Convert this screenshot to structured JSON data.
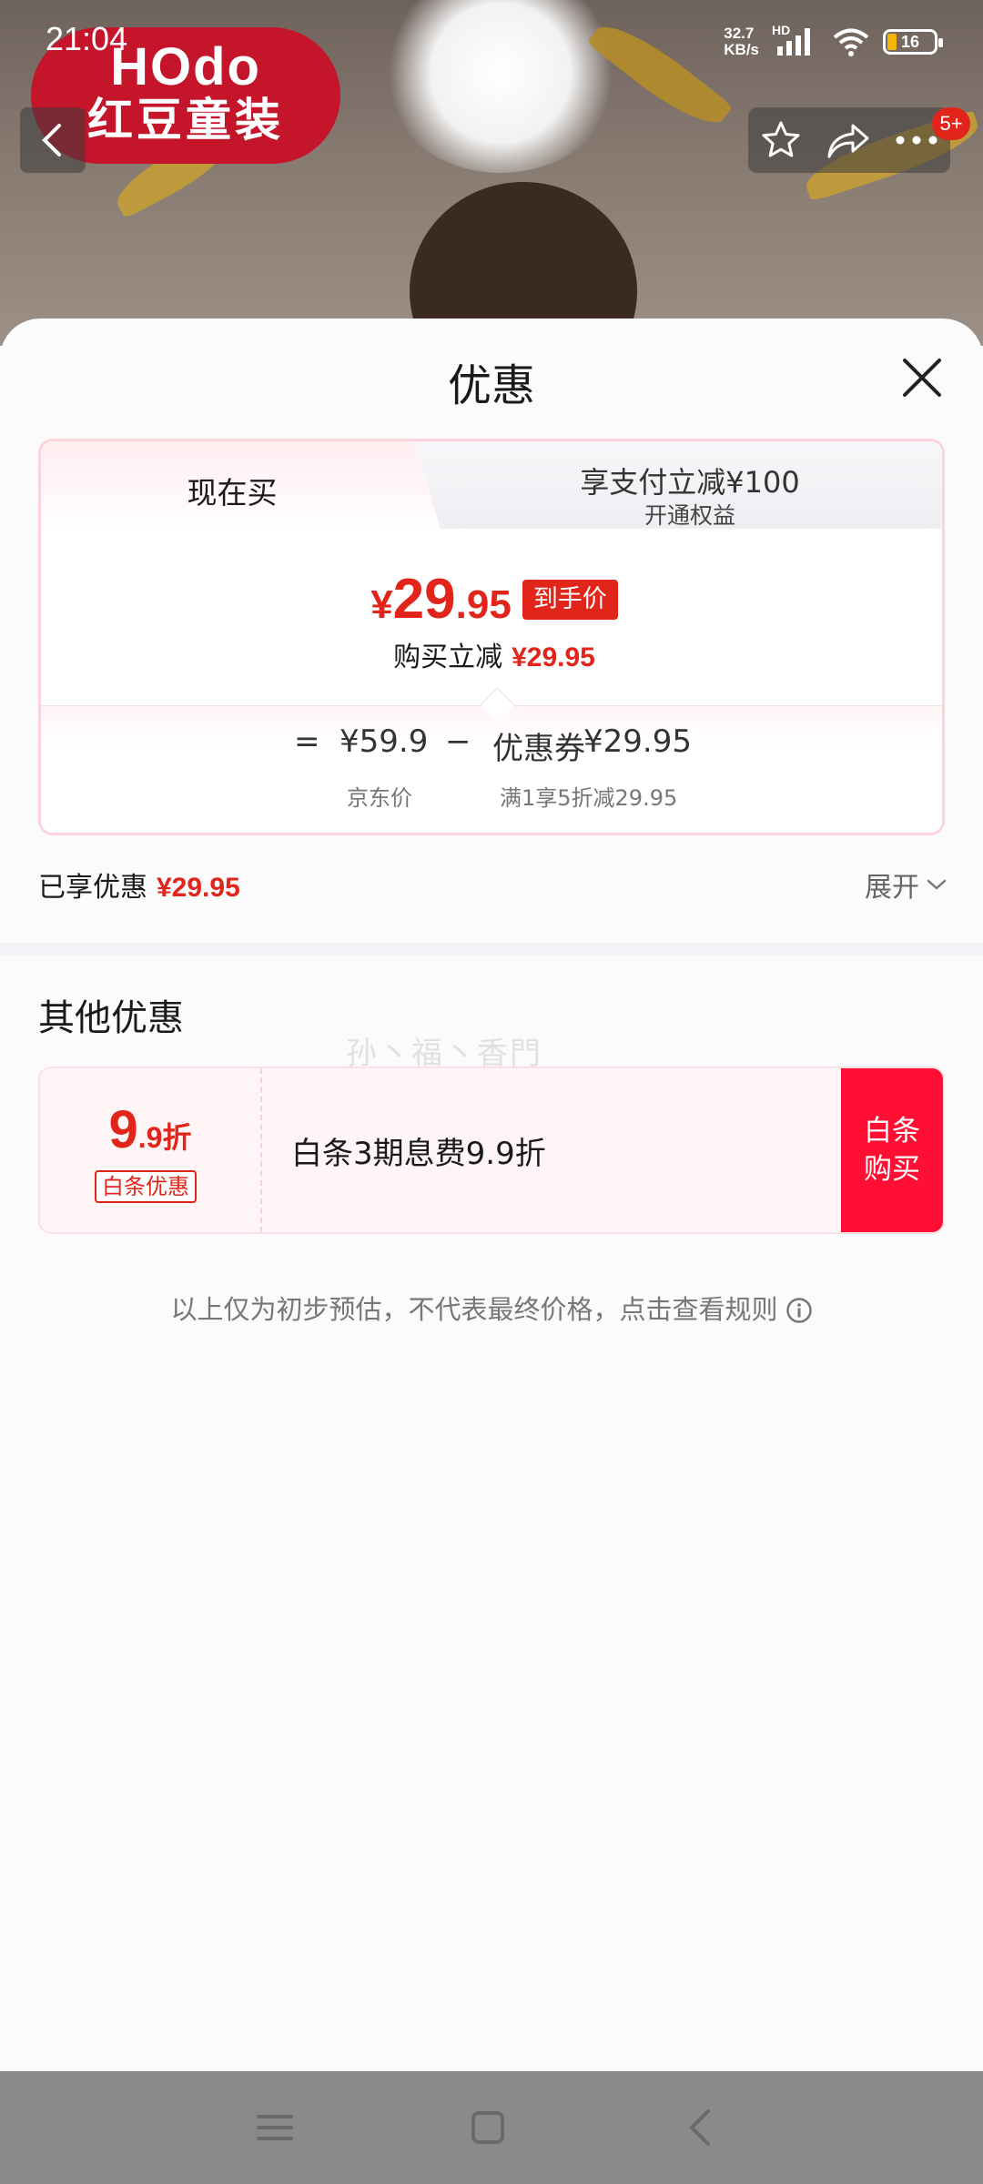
{
  "status_bar": {
    "time": "21:04",
    "net_speed_value": "32.7",
    "net_speed_unit": "KB/s",
    "network_tag": "HD",
    "battery": "16"
  },
  "hero": {
    "brand_logo_en": "HOdo",
    "brand_logo_cn": "红豆童装"
  },
  "top_nav": {
    "badge": "5+"
  },
  "sheet": {
    "title": "优惠",
    "tabs": {
      "active": "现在买",
      "other_main": "享支付立减¥100",
      "other_sub": "开通权益"
    },
    "final_price": {
      "yen": "¥",
      "integer": "29",
      "decimal": ".95",
      "tag": "到手价"
    },
    "reduce": {
      "label": "购买立减",
      "amount": "¥29.95"
    },
    "calc": {
      "equals": "=",
      "jd_price": "¥59.9",
      "minus": "−",
      "coupon_label": "优惠券",
      "coupon_value": "¥29.95",
      "jd_price_label": "京东价",
      "coupon_rule": "满1享5折减29.95"
    },
    "enjoyed": {
      "label": "已享优惠",
      "amount": "¥29.95",
      "expand": "展开"
    },
    "other": {
      "title": "其他优惠",
      "watermark": "孙丶福丶香門",
      "coupon": {
        "rate_big": "9",
        "rate_small": ".9折",
        "tag": "白条优惠",
        "desc": "白条3期息费9.9折",
        "button": "白条购买"
      }
    },
    "disclaimer": "以上仅为初步预估，不代表最终价格，点击查看规则"
  },
  "colors": {
    "accent_red": "#e1251b",
    "button_red": "#ff0f33",
    "card_border": "#fbd4dc"
  }
}
